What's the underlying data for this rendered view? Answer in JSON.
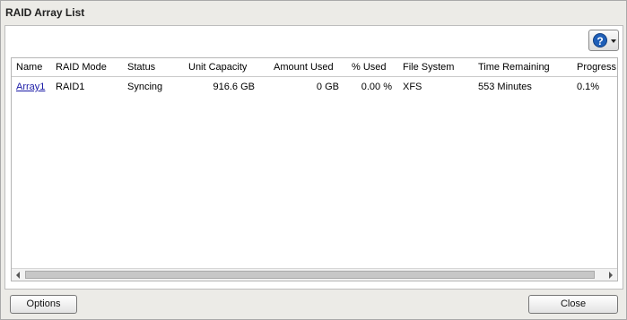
{
  "window": {
    "title": "RAID Array List"
  },
  "help": {
    "glyph": "?",
    "icon": "help-icon"
  },
  "table": {
    "columns": [
      "Name",
      "RAID Mode",
      "Status",
      "Unit Capacity",
      "Amount Used",
      "% Used",
      "File System",
      "Time Remaining",
      "Progress"
    ],
    "rows": [
      [
        "Array1",
        "RAID1",
        "Syncing",
        "916.6 GB",
        "0 GB",
        "0.00 %",
        "XFS",
        "553 Minutes",
        "0.1%"
      ]
    ]
  },
  "footer": {
    "options_label": "Options",
    "close_label": "Close"
  }
}
